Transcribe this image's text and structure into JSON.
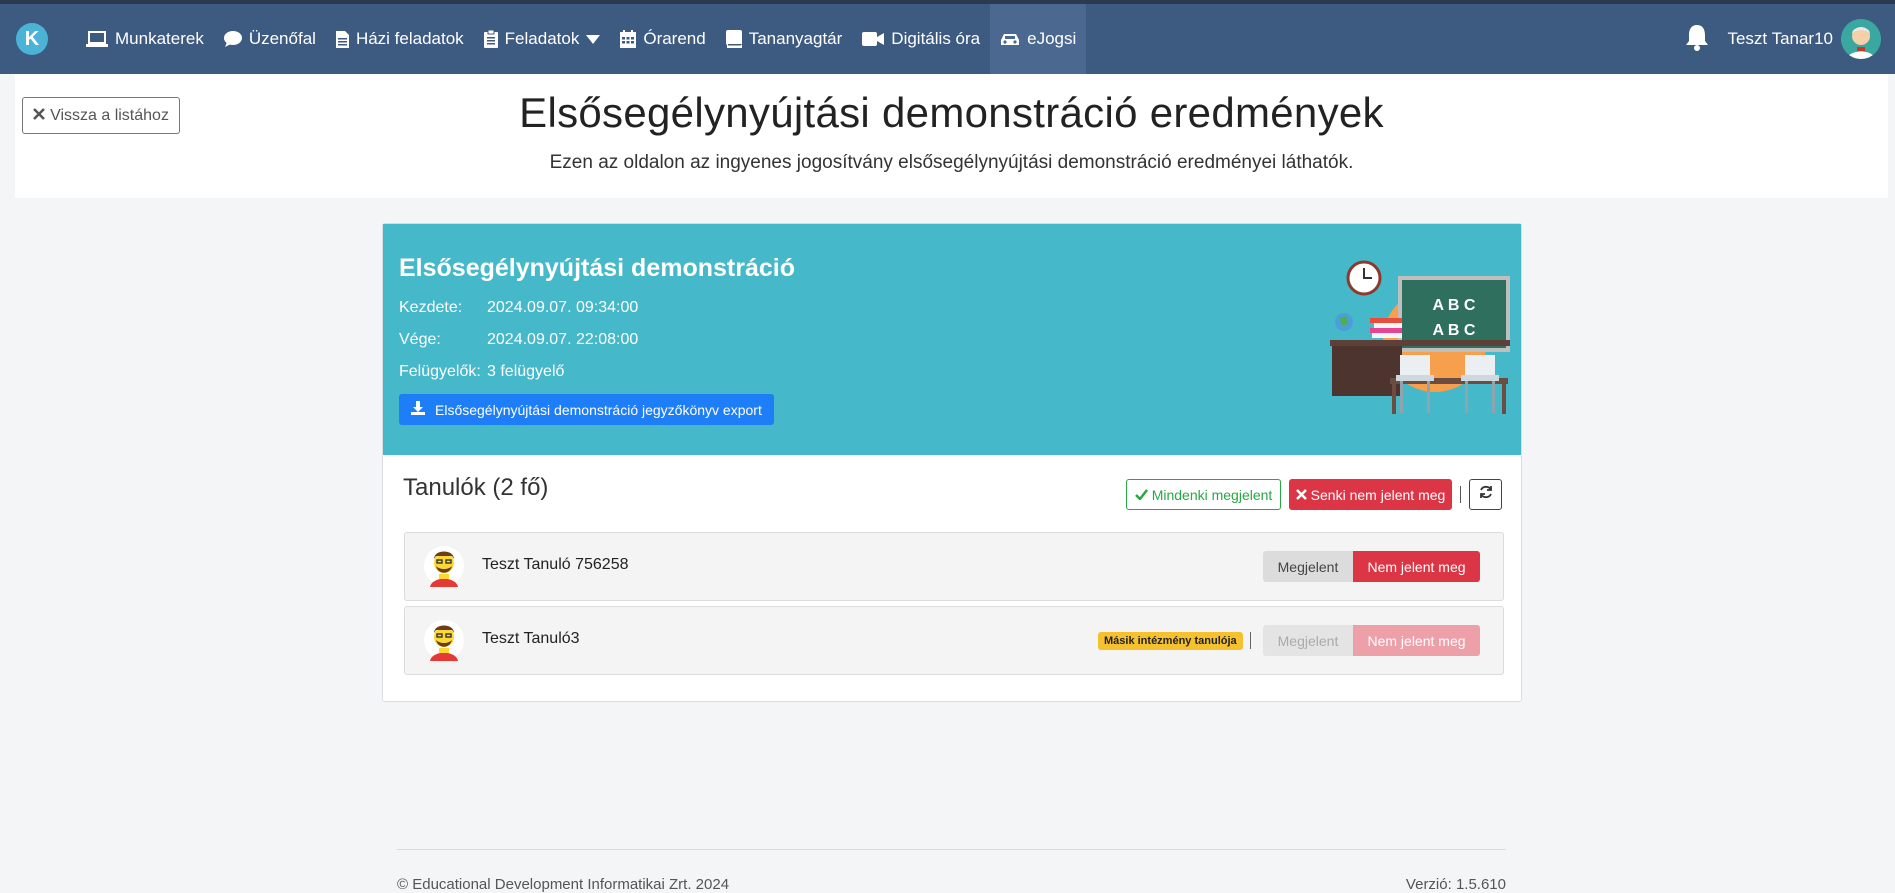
{
  "navbar": {
    "logo_letter": "K",
    "items": [
      {
        "label": "Munkaterek",
        "icon": "laptop-icon"
      },
      {
        "label": "Üzenőfal",
        "icon": "speech-bubble-icon"
      },
      {
        "label": "Házi feladatok",
        "icon": "document-icon"
      },
      {
        "label": "Feladatok",
        "icon": "clipboard-icon"
      },
      {
        "label": "Órarend",
        "icon": "calendar-icon"
      },
      {
        "label": "Tananyagtár",
        "icon": "book-icon"
      },
      {
        "label": "Digitális óra",
        "icon": "video-camera-icon"
      },
      {
        "label": "eJogsi",
        "icon": "car-icon"
      }
    ],
    "active_item": "eJogsi",
    "user_name": "Teszt Tanar10"
  },
  "header": {
    "back_label": "Vissza a listához",
    "title": "Elsősegélynyújtási demonstráció eredmények",
    "subtitle": "Ezen az oldalon az ingyenes jogosítvány elsősegélynyújtási demonstráció eredményei láthatók."
  },
  "exam": {
    "title": "Elsősegélynyújtási demonstráció",
    "start_label": "Kezdete:",
    "start_value": "2024.09.07. 09:34:00",
    "end_label": "Vége:",
    "end_value": "2024.09.07. 22:08:00",
    "supervisors_label": "Felügyelők:",
    "supervisors_value": "3 felügyelő",
    "export_label": "Elsősegélynyújtási demonstráció jegyzőkönyv export",
    "board_text_1": "A B C",
    "board_text_2": "A B C"
  },
  "students": {
    "title": "Tanulók (2 fő)",
    "all_present_label": "Mindenki megjelent",
    "none_present_label": "Senki nem jelent meg",
    "rows": [
      {
        "name": "Teszt Tanuló 756258",
        "badge": "",
        "present_label": "Megjelent",
        "absent_label": "Nem jelent meg",
        "status": "absent",
        "disabled": false
      },
      {
        "name": "Teszt Tanuló3",
        "badge": "Másik intézmény tanulója",
        "present_label": "Megjelent",
        "absent_label": "Nem jelent meg",
        "status": "absent",
        "disabled": true
      }
    ]
  },
  "footer": {
    "copyright": "© Educational Development Informatikai Zrt. 2024",
    "version": "Verzió: 1.5.610"
  },
  "colors": {
    "navbar": "#3d5a80",
    "card_header": "#45b8c9",
    "primary": "#1e7ef7",
    "danger": "#dc3545",
    "success": "#28a745",
    "warning": "#f5c12e"
  }
}
